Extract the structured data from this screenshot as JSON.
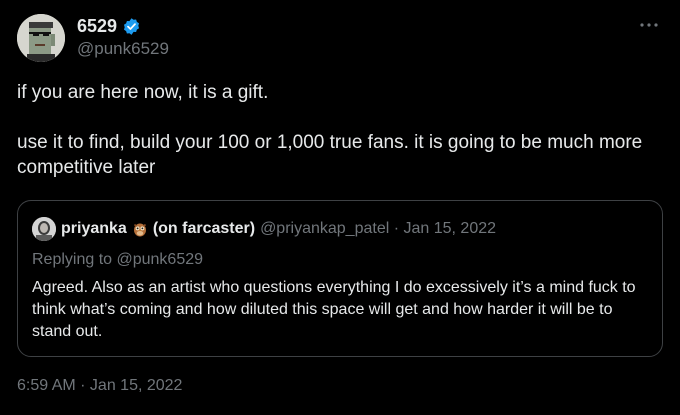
{
  "author": {
    "name": "6529",
    "handle": "@punk6529",
    "verified": true,
    "avatar": "pixel-punk-avatar"
  },
  "tweet": {
    "paragraphs": [
      "if you are here now, it is a gift.",
      "use it to find, build your 100 or 1,000 true fans.   it is going to be much more competitive later"
    ]
  },
  "quote": {
    "name": "priyanka",
    "name_suffix": "(on farcaster)",
    "name_emoji": "owl-icon",
    "handle_date": "@priyankap_patel · Jan 15, 2022",
    "replying_to": "Replying to @punk6529",
    "text": "Agreed. Also as an artist who questions everything I do excessively it’s a mind fuck to think what’s coming and how diluted this space will get and how harder it will be to stand out."
  },
  "timestamp": "6:59 AM · Jan 15, 2022",
  "colors": {
    "background": "#000000",
    "text": "#e7e9ea",
    "muted": "#71767b",
    "verified": "#1d9bf0",
    "border": "#3e4144"
  }
}
